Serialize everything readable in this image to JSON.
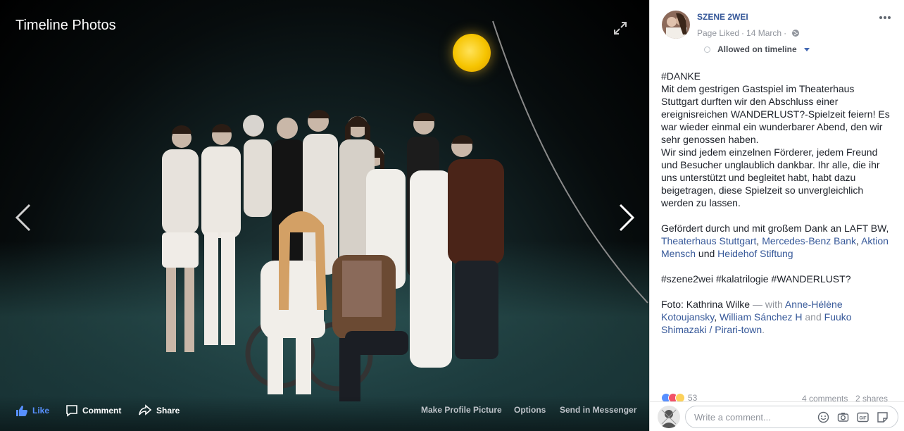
{
  "viewer": {
    "title": "Timeline Photos",
    "actions": {
      "like": "Like",
      "comment": "Comment",
      "share": "Share",
      "make_profile_picture": "Make Profile Picture",
      "options": "Options",
      "send_in_messenger": "Send in Messenger"
    },
    "icons": [
      "expand-icon",
      "chevron-left-icon",
      "chevron-right-icon",
      "thumbs-up-icon",
      "comment-bubble-icon",
      "share-arrow-icon"
    ]
  },
  "post": {
    "page_name": "SZENE 2WEI",
    "page_liked": "Page Liked",
    "separator": "·",
    "date": "14 March",
    "privacy_icon": "globe-icon",
    "allowed_label": "Allowed on timeline",
    "p1_heading": "#DANKE",
    "p1_body": "Mit dem gestrigen Gastspiel im Theaterhaus Stuttgart durften wir den Abschluss einer ereignisreichen WANDERLUST?-Spielzeit feiern! Es war wieder einmal ein wunderbarer Abend, den wir sehr genossen haben.",
    "p2_body": "Wir sind jedem einzelnen Förderer, jedem Freund und Besucher unglaublich dankbar. Ihr alle, die ihr uns unterstützt und begleitet habt, habt dazu beigetragen, diese Spielzeit so unvergleichlich werden zu lassen.",
    "p3_intro": "Gefördert durch und mit großem Dank an LAFT BW,",
    "p3_link1": "Theaterhaus Stuttgart",
    "p3_comma1": ",",
    "p3_link2": "Mercedes-Benz Bank",
    "p3_comma2": ",",
    "p3_link3": "Aktion Mensch",
    "p3_und": "und",
    "p3_link4": "Heidehof Stiftung",
    "hashtags": "#szene2wei #kalatrilogie #WANDERLUST?",
    "photo_credit": "Foto: Kathrina Wilke",
    "with_label": "— with",
    "tag1": "Anne-Hélène Kotoujansky",
    "tag_comma": ",",
    "tag2": "William Sánchez H",
    "tag_and": "and",
    "tag3": "Fuuko Shimazaki / Pirari-town",
    "tag_period": "."
  },
  "engagement": {
    "reaction_count": "53",
    "comments": "4 comments",
    "shares": "2 shares",
    "reaction_colors": [
      "#5890ff",
      "#f25268",
      "#fcd15b"
    ]
  },
  "composer": {
    "placeholder": "Write a comment...",
    "icons": [
      "emoji-icon",
      "camera-icon",
      "gif-icon",
      "sticker-icon"
    ]
  }
}
